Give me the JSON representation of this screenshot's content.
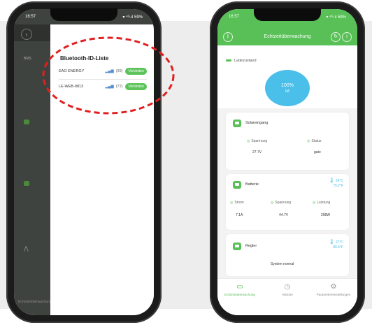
{
  "left_phone": {
    "status_time": "16:57",
    "status_right": "▾ ⁴ᴳ.ıl 59%",
    "drawer": {
      "title": "Bluetooth-ID-Liste",
      "devices": [
        {
          "name": "EAO ENERGY",
          "rssi": "(39)",
          "button": "Verbinden"
        },
        {
          "name": "LE-WEB-9813",
          "rssi": "(72)",
          "button": "Verbinden"
        }
      ]
    },
    "app_tag": "BMS",
    "nav_label": "Echtzeitüberwachung"
  },
  "right_phone": {
    "status_time": "16:57",
    "status_right": "▾ ⁴ᴳ.ıl 59%",
    "header_title": "Echtzeitüberwachung",
    "soc": {
      "label": "Ladezustand",
      "percent": "100%",
      "value": "0A"
    },
    "charge_input": {
      "title": "Solareingang",
      "metrics": [
        {
          "label": "Spannung",
          "value": "27.7V"
        },
        {
          "label": "Status",
          "value": "gate"
        }
      ]
    },
    "battery": {
      "title": "Batterie",
      "temp_c": "24°C",
      "temp_f": "75.2°F",
      "metrics": [
        {
          "label": "Strom",
          "value": "7.1A"
        },
        {
          "label": "Spannung",
          "value": "44.7V"
        },
        {
          "label": "Leistung",
          "value": "298W"
        }
      ]
    },
    "controller": {
      "title": "Regler",
      "temp_c": "27°C",
      "temp_f": "80.6°F",
      "status": "System normal"
    },
    "nav": [
      {
        "label": "Echtzeitüberwachung",
        "icon": "monitor-icon"
      },
      {
        "label": "Historie",
        "icon": "history-icon"
      },
      {
        "label": "Parametereinstellungen",
        "icon": "settings-icon"
      }
    ]
  },
  "colors": {
    "accent": "#58c056",
    "soc_circle": "#49bfe9",
    "annotation": "#e02020"
  }
}
